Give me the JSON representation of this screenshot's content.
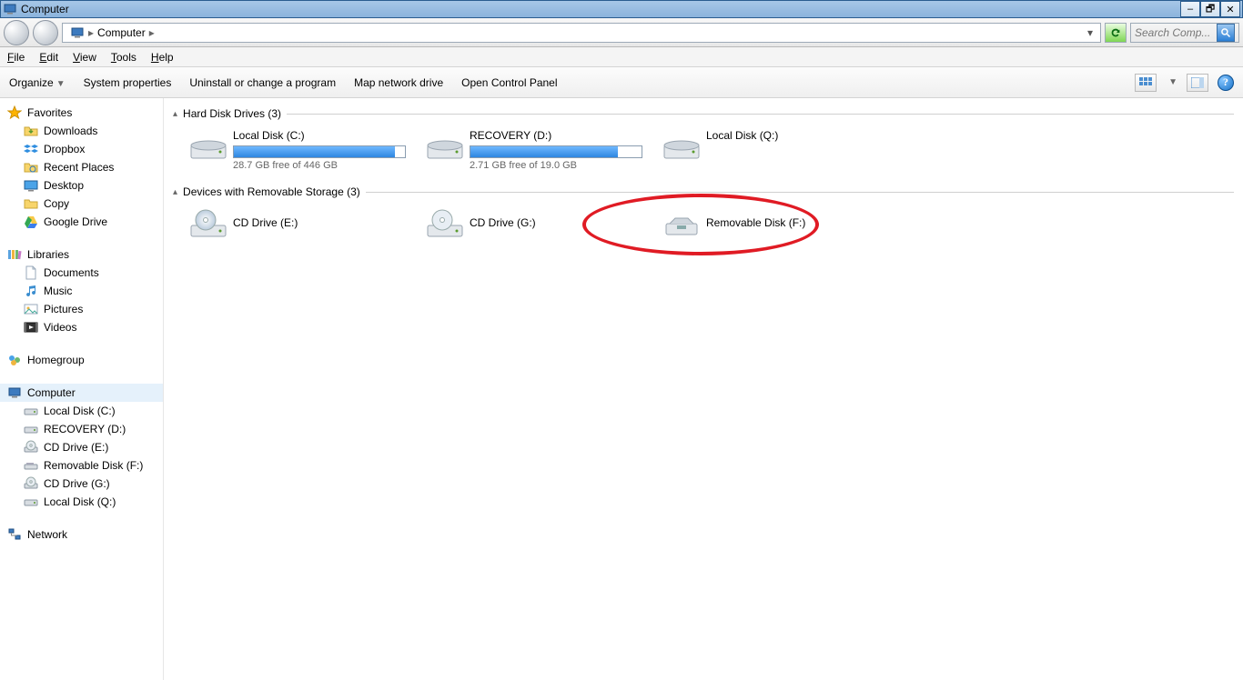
{
  "window": {
    "title": "Computer"
  },
  "address": {
    "location": "Computer",
    "dropdown_hint": "▾"
  },
  "search": {
    "placeholder": "Search Comp..."
  },
  "menubar": {
    "file": "File",
    "edit": "Edit",
    "view": "View",
    "tools": "Tools",
    "help": "Help"
  },
  "cmdbar": {
    "organize": "Organize",
    "sysprops": "System properties",
    "uninstall": "Uninstall or change a program",
    "mapdrive": "Map network drive",
    "controlpanel": "Open Control Panel"
  },
  "nav": {
    "favorites": {
      "label": "Favorites",
      "items": [
        "Downloads",
        "Dropbox",
        "Recent Places",
        "Desktop",
        "Copy",
        "Google Drive"
      ]
    },
    "libraries": {
      "label": "Libraries",
      "items": [
        "Documents",
        "Music",
        "Pictures",
        "Videos"
      ]
    },
    "homegroup": {
      "label": "Homegroup"
    },
    "computer": {
      "label": "Computer",
      "items": [
        "Local Disk (C:)",
        "RECOVERY (D:)",
        "CD Drive (E:)",
        "Removable Disk (F:)",
        "CD Drive (G:)",
        "Local Disk (Q:)"
      ]
    },
    "network": {
      "label": "Network"
    }
  },
  "sections": {
    "hdd": {
      "title": "Hard Disk Drives (3)"
    },
    "removable": {
      "title": "Devices with Removable Storage (3)"
    }
  },
  "drives": {
    "c": {
      "name": "Local Disk (C:)",
      "free": "28.7 GB free of 446 GB",
      "fillpct": "94%"
    },
    "d": {
      "name": "RECOVERY (D:)",
      "free": "2.71 GB free of 19.0 GB",
      "fillpct": "86%"
    },
    "q": {
      "name": "Local Disk (Q:)"
    },
    "e": {
      "name": "CD Drive (E:)"
    },
    "g": {
      "name": "CD Drive (G:)"
    },
    "f": {
      "name": "Removable Disk (F:)"
    }
  }
}
